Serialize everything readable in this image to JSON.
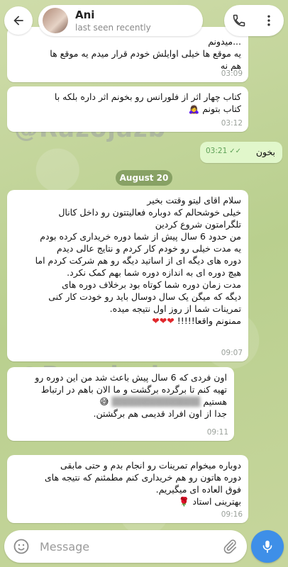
{
  "header": {
    "contact_name": "Ani",
    "status": "last seen recently"
  },
  "messages": [
    {
      "id": "m1",
      "direction": "in",
      "lines": [
        "...میدونم",
        "یه موقع ها خیلی اوایلش خودم قرار میدم یه موقع ها",
        "هم نه"
      ],
      "time": "03:09"
    },
    {
      "id": "m2",
      "direction": "in",
      "lines": [
        "کتاب چهار اثر از فلورانس رو بخونم اثر داره بلکه با",
        "کتاب بتونم 🙇‍♀️"
      ],
      "time": "03:12"
    },
    {
      "id": "m3",
      "direction": "out",
      "lines": [
        "بخون"
      ],
      "time": "03:21"
    },
    {
      "id": "m4",
      "direction": "in",
      "lines": [
        "سلام اقای لیتو وقتت بخیر",
        "خیلی خوشحالم که دوباره فعالیتتون رو داخل کانال",
        "تلگرامتون شروع کردین",
        "من حدود 6 سال پیش از شما دوره خریداری کرده بودم",
        "یه مدت خیلی رو خودم کار کردم و نتایج عالی دیدم",
        "دوره های دیگه ای از اساتید دیگه رو هم شرکت کردم اما",
        "هیچ دوره ای به اندازه دوره شما بهم کمک نکرد.",
        "مدت زمان دوره شما کوتاه بود برخلاف دوره های",
        "دیگه که میگن یک سال دوسال باید رو خودت کار کنی",
        "تمرینات شما از روز اول نتیجه میده.",
        "ممنونم واقعا!!!!!"
      ],
      "hearts": "❤❤❤",
      "time": "09:07"
    },
    {
      "id": "m5",
      "direction": "in",
      "lines": [
        "اون فردی که 6 سال پیش باعث شد من این دوره رو",
        "تهیه کنم تا برگرده برگشت و ما الان باهم در ارتباط",
        "هستیم",
        "جدا از اون افراد قدیمی هم برگشتن."
      ],
      "emoji": "😅",
      "time": "09:11"
    },
    {
      "id": "m6",
      "direction": "in",
      "lines": [
        "دوباره میخوام تمرینات رو انجام بدم و حتی مابقی",
        "دوره هاتون رو هم خریداری کنم مطمئنم که نتیجه های",
        "فوق العاده ای میگیریم.",
        "بهترینی استاد 🌹"
      ],
      "time": "09:16"
    }
  ],
  "date_separator": "August 20",
  "watermarks": [
    "@Razojazb",
    "@Razojazb"
  ],
  "input": {
    "placeholder": "Message"
  },
  "colors": {
    "outgoing_bubble": "#e1f7cb",
    "incoming_bubble": "#ffffff",
    "accent": "#3e8fe8"
  }
}
